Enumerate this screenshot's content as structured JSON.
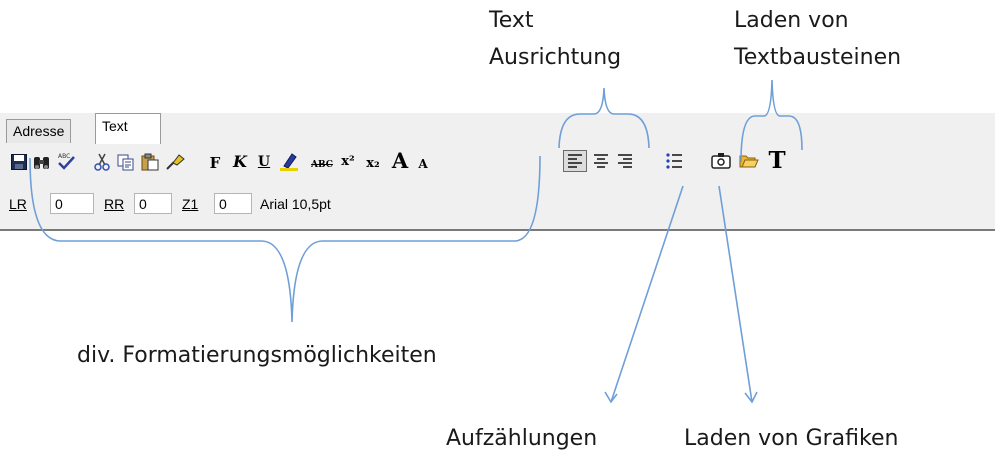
{
  "annotations": {
    "text_alignment_line1": "Text",
    "text_alignment_line2": "Ausrichtung",
    "load_blocks_line1": "Laden von",
    "load_blocks_line2": "Textbausteinen",
    "formatting": "div. Formatierungsmöglichkeiten",
    "lists": "Aufzählungen",
    "load_graphics": "Laden von Grafiken"
  },
  "tabs": [
    {
      "label": "Adresse",
      "active": false
    },
    {
      "label": "Text",
      "active": true
    }
  ],
  "toolbar": {
    "bold": "F",
    "italic": "K",
    "underline": "U",
    "strike": "ABC",
    "superscript": "x²",
    "subscript": "x₂",
    "grow_font": "A",
    "shrink_font": "A",
    "text_block": "T"
  },
  "fields": {
    "lr_label": "LR",
    "lr_value": "0",
    "rr_label": "RR",
    "rr_value": "0",
    "z1_label": "Z1",
    "z1_value": "0",
    "font_info": "Arial 10,5pt"
  },
  "colors": {
    "annotation_line": "#6f9fd8",
    "toolbar_bg": "#f0f0f0"
  },
  "icons": [
    "save-icon",
    "find-icon",
    "spellcheck-icon",
    "cut-icon",
    "copy-icon",
    "paste-icon",
    "format-painter-icon",
    "highlight-icon",
    "align-left-icon",
    "align-center-icon",
    "align-right-icon",
    "bullet-list-icon",
    "insert-graphic-icon",
    "open-folder-icon",
    "text-block-icon"
  ]
}
